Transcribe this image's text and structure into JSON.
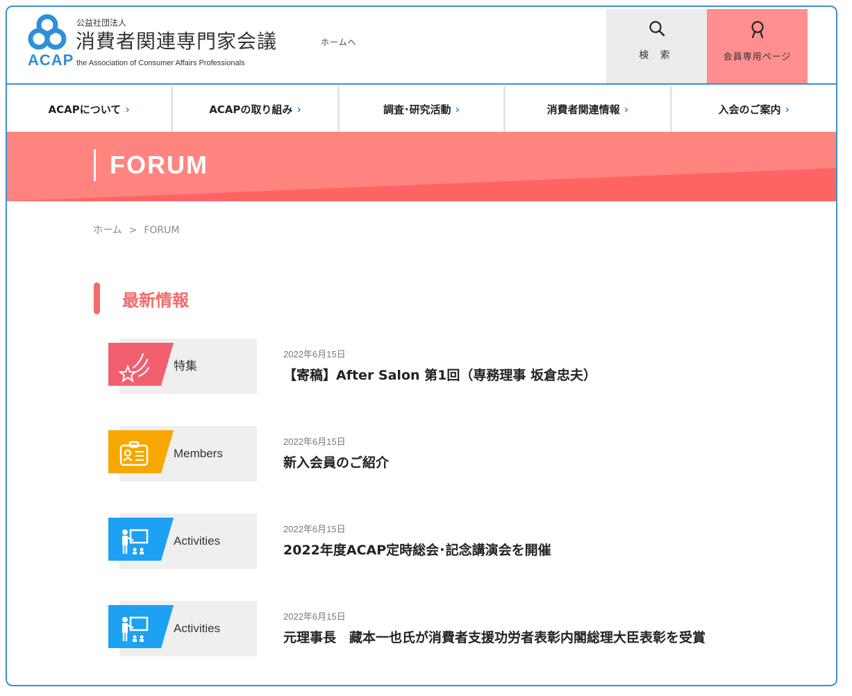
{
  "header": {
    "org_small": "公益社団法人",
    "org_name": "消費者関連専門家会議",
    "org_en": "the Association of Consumer Affairs Professionals",
    "logo_text": "ACAP",
    "home_link": "ホームへ",
    "search_label": "検 索",
    "member_label": "会員専用ページ",
    "colors": {
      "accent": "#3a8fd0",
      "member": "#ff8f8f",
      "search_bg": "#ececec"
    }
  },
  "nav": {
    "items": [
      {
        "label": "ACAPについて"
      },
      {
        "label": "ACAPの取り組み"
      },
      {
        "label": "調査･研究活動"
      },
      {
        "label": "消費者関連情報"
      },
      {
        "label": "入会のご案内"
      }
    ],
    "chevron": "›"
  },
  "banner": {
    "title": "FORUM",
    "colors": {
      "top": "#ff8480",
      "bottom": "#ff6464"
    }
  },
  "breadcrumb": {
    "home": "ホーム",
    "separator": ">",
    "current": "FORUM"
  },
  "section": {
    "title": "最新情報",
    "color": "#f36b6b"
  },
  "news": [
    {
      "category": "特集",
      "icon": "star-icon",
      "color": "#f26070",
      "date": "2022年6月15日",
      "title": "【寄稿】After Salon 第1回（専務理事 坂倉忠夫）"
    },
    {
      "category": "Members",
      "icon": "id-card-icon",
      "color": "#f7a800",
      "date": "2022年6月15日",
      "title": "新入会員のご紹介"
    },
    {
      "category": "Activities",
      "icon": "presentation-icon",
      "color": "#1da1f2",
      "date": "2022年6月15日",
      "title": "2022年度ACAP定時総会･記念講演会を開催"
    },
    {
      "category": "Activities",
      "icon": "presentation-icon",
      "color": "#1da1f2",
      "date": "2022年6月15日",
      "title": "元理事長　藏本一也氏が消費者支援功労者表彰内閣総理大臣表彰を受賞"
    }
  ]
}
